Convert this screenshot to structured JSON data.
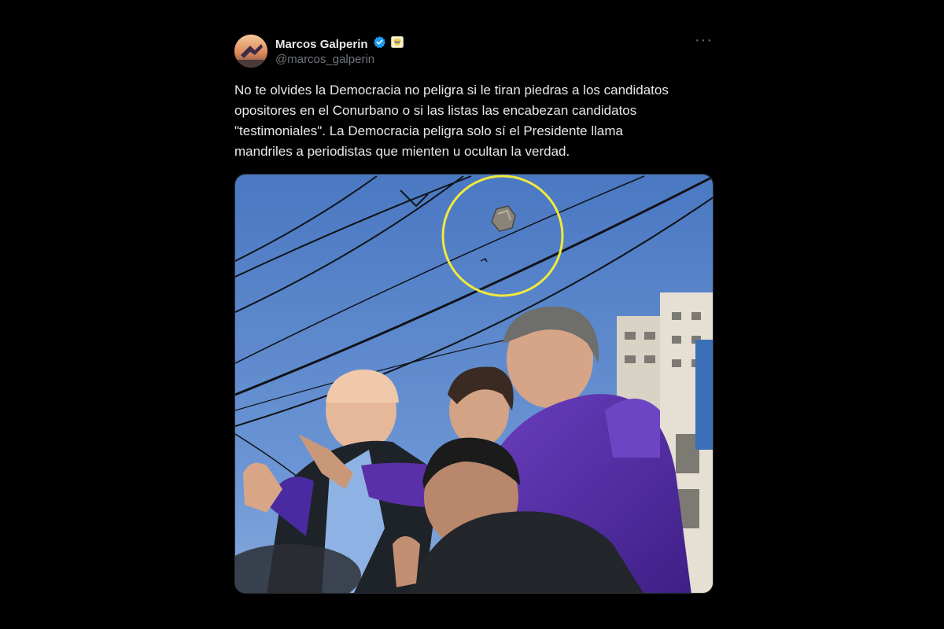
{
  "theme": {
    "background": "#000000",
    "text": "#e7e9ea",
    "muted": "#71767b",
    "verified": "#1d9bf0",
    "highlight_circle": "#f2ea3a",
    "jacket": "#5b2fa8",
    "sky": "#4f7fc5"
  },
  "tweet": {
    "author": {
      "display_name": "Marcos Galperin",
      "handle": "@marcos_galperin",
      "verified_icon": "verified-badge-icon",
      "affiliate_icon": "affiliate-badge-icon"
    },
    "more_label": "···",
    "text": "No te olvides la Democracia no peligra si le tiran piedras a los candidatos\nopositores en el Conurbano o si las listas las encabezan candidatos\n\"testimoniales\". La Democracia peligra solo sí el Presidente llama\nmandriles a periodistas que mienten u ocultan la verdad.",
    "media": {
      "kind": "photo",
      "icon": "photo-attachment"
    }
  }
}
